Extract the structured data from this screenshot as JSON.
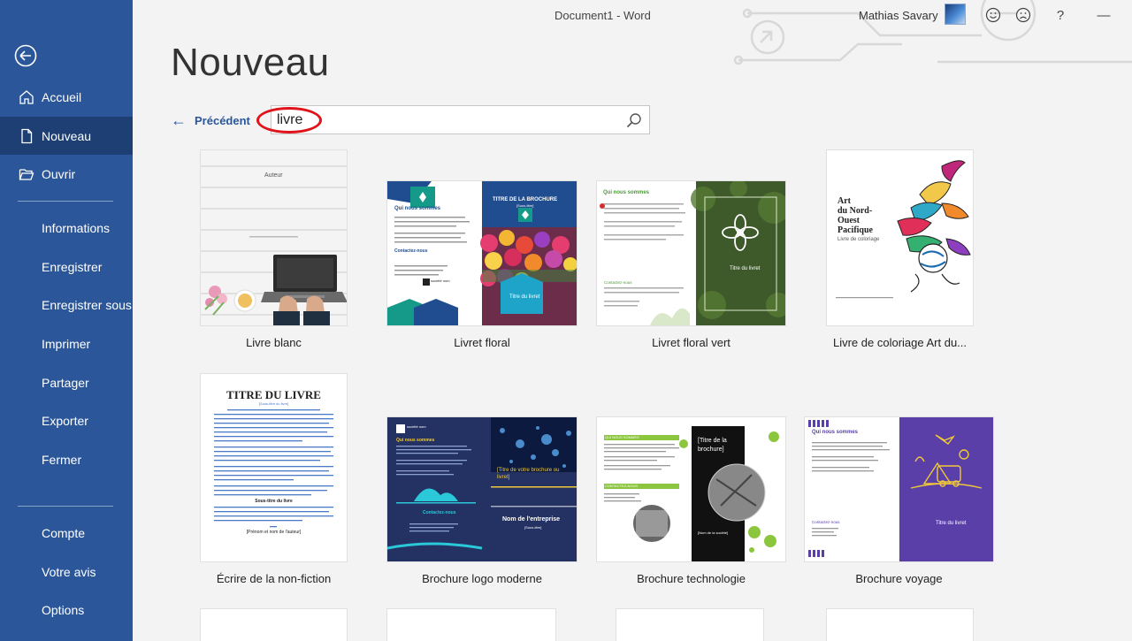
{
  "titlebar": {
    "document_title": "Document1  -  Word",
    "user_name": "Mathias Savary",
    "help": "?",
    "minimize": "—"
  },
  "sidebar": {
    "items": [
      {
        "label": "Accueil",
        "icon": "home-icon"
      },
      {
        "label": "Nouveau",
        "icon": "new-document-icon"
      },
      {
        "label": "Ouvrir",
        "icon": "folder-open-icon"
      },
      {
        "label": "Informations"
      },
      {
        "label": "Enregistrer"
      },
      {
        "label": "Enregistrer sous"
      },
      {
        "label": "Imprimer"
      },
      {
        "label": "Partager"
      },
      {
        "label": "Exporter"
      },
      {
        "label": "Fermer"
      },
      {
        "label": "Compte"
      },
      {
        "label": "Votre avis"
      },
      {
        "label": "Options"
      }
    ]
  },
  "main": {
    "heading": "Nouveau",
    "back_label": "Précédent",
    "search": {
      "value": "livre"
    },
    "templates": [
      {
        "name": "Livre blanc"
      },
      {
        "name": "Livret floral"
      },
      {
        "name": "Livret floral vert"
      },
      {
        "name": "Livre de coloriage Art du..."
      },
      {
        "name": "Écrire de la non-fiction"
      },
      {
        "name": "Brochure logo moderne"
      },
      {
        "name": "Brochure technologie"
      },
      {
        "name": "Brochure voyage"
      }
    ]
  },
  "thumbs": {
    "livre_blanc": {
      "author": "Auteur"
    },
    "floral": {
      "heading": "Qui nous sommes",
      "right_title": "TITRE DE LA BROCHURE",
      "right_sub": "[Sous-titre]",
      "contact": "Contactez-nous",
      "bottom": "Titre du livret",
      "company": "société nom"
    },
    "floral_vert": {
      "heading": "Qui nous sommes",
      "contact": "Contactez-nous",
      "right_title": "Titre du livret"
    },
    "coloriage": {
      "title_lines": [
        "Art",
        "du Nord-",
        "Ouest",
        "Pacifique"
      ],
      "subtitle": "Livre de coloriage"
    },
    "nonfiction": {
      "title": "TITRE DU LIVRE",
      "subtitle": "[Sous-titre du livre]",
      "section": "Sous-titre du livre",
      "author": "[Prénom et nom de l'auteur]"
    },
    "logo_moderne": {
      "company": "société nom",
      "heading": "Qui nous sommes",
      "right_title": "[Titre de votre brochure ou livret]",
      "company_name": "Nom de l'entreprise",
      "sub": "[Sous-titre]",
      "contact": "Contactez-nous"
    },
    "technologie": {
      "heading": "QUI NOUS SOMMES",
      "contact": "CONTACTEZ-NOUS",
      "right_title": "[Titre de la brochure]",
      "company": "[Nom de la société]"
    },
    "voyage": {
      "heading": "Qui nous sommes",
      "contact": "Contactez-nous",
      "right_title": "Titre du livret"
    }
  },
  "colors": {
    "sidebar": "#2b579a",
    "sidebar_active": "#1e3f73",
    "accent": "#2b579a",
    "highlight_circle": "#e0131a"
  }
}
